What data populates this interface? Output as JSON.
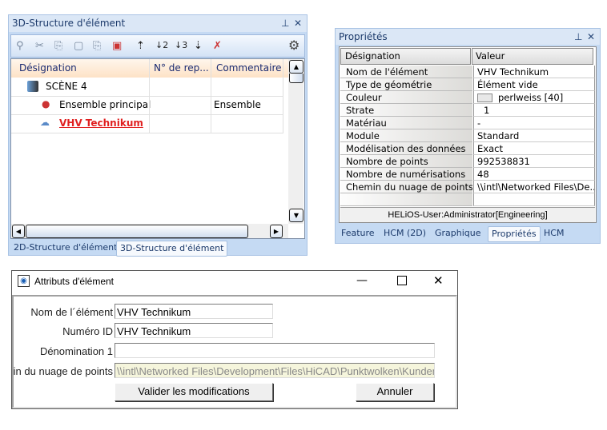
{
  "structure_panel": {
    "title": "3D-Structure d'élément",
    "columns": [
      "Désignation",
      "N° de rep...",
      "Commentaire"
    ],
    "rows": [
      {
        "name": "SCÈNE 4",
        "number": "",
        "comment": ""
      },
      {
        "name": "Ensemble principal",
        "number": "",
        "comment": "Ensemble"
      },
      {
        "name": "VHV Technikum",
        "number": "",
        "comment": ""
      }
    ],
    "tabs": [
      "2D-Structure d'élément",
      "3D-Structure d'élément"
    ],
    "active_tab": "3D-Structure d'élément"
  },
  "properties_panel": {
    "title": "Propriétés",
    "columns": [
      "Désignation",
      "Valeur"
    ],
    "rows": [
      {
        "label": "Nom de l'élément",
        "value": "VHV Technikum"
      },
      {
        "label": "Type de géométrie",
        "value": "Élément vide"
      },
      {
        "label": "Couleur",
        "value": "perlweiss [40]"
      },
      {
        "label": "Strate",
        "value": "1"
      },
      {
        "label": "Matériau",
        "value": "-"
      },
      {
        "label": "Module",
        "value": "Standard"
      },
      {
        "label": "Modélisation des données",
        "value": "Exact"
      },
      {
        "label": "Nombre de points",
        "value": "992538831"
      },
      {
        "label": "Nombre de numérisations",
        "value": "48"
      },
      {
        "label": "Chemin du nuage de points",
        "value": "\\\\intl\\Networked Files\\De..."
      }
    ],
    "status": "HELiOS-User:Administrator[Engineering]",
    "tabs": [
      "Feature",
      "HCM (2D)",
      "Graphique",
      "Propriétés",
      "HCM"
    ],
    "active_tab": "Propriétés",
    "color_swatch": "#e8e8e8"
  },
  "dialog": {
    "title": "Attributs d'élément",
    "fields": [
      {
        "label": "Nom de l´élément",
        "value": "VHV Technikum"
      },
      {
        "label": "Numéro ID",
        "value": "VHV Technikum"
      },
      {
        "label": "Dénomination 1",
        "value": ""
      },
      {
        "label": "Chemin du nuage de points",
        "value": "\\\\intl\\Networked Files\\Development\\Files\\HiCAD\\Punktwolken\\Kunden"
      }
    ],
    "ok_label": "Valider les modifications",
    "cancel_label": "Annuler"
  }
}
